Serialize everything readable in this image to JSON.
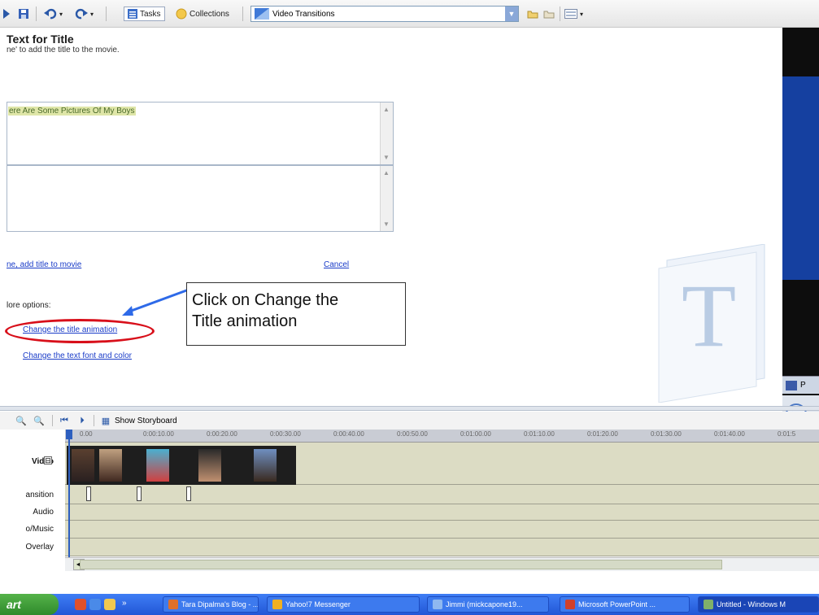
{
  "toolbar": {
    "tasks_label": "Tasks",
    "collections_label": "Collections",
    "collection_combo": "Video Transitions"
  },
  "task_pane": {
    "heading": "Text for Title",
    "instruction": "ne' to add the title to the movie.",
    "title_text": "ere Are Some Pictures Of My Boys",
    "second_line_text": "",
    "done_link": "ne, add title to movie",
    "cancel_link": "Cancel",
    "more_options": "lore options:",
    "change_animation_link": "Change the title animation",
    "change_font_link": "Change the text font and color"
  },
  "callout": {
    "line1": "Click on Change the",
    "line2": "Title animation"
  },
  "preview": {
    "label": "P"
  },
  "timeline": {
    "show_storyboard": "Show Storyboard",
    "ruler_ticks": [
      "0.00",
      "0:00:10.00",
      "0:00:20.00",
      "0:00:30.00",
      "0:00:40.00",
      "0:00:50.00",
      "0:01:00.00",
      "0:01:10.00",
      "0:01:20.00",
      "0:01:30.00",
      "0:01:40.00",
      "0:01:5"
    ],
    "tracks": {
      "video": "Video",
      "transition": "ansition",
      "audio": "Audio",
      "music": "o/Music",
      "overlay": "Overlay"
    },
    "collapse_symbol": "⊟"
  },
  "taskbar": {
    "start": "art",
    "tasks": [
      {
        "label": "Tara Dipalma's Blog - ...",
        "icon_color": "#e0702a"
      },
      {
        "label": "Yahoo!7 Messenger",
        "icon_color": "#f0b020"
      },
      {
        "label": "Jimmi (mickcapone19...",
        "icon_color": "#8fb8f0"
      },
      {
        "label": "Microsoft PowerPoint ...",
        "icon_color": "#d0402a"
      },
      {
        "label": "Untitled - Windows M",
        "icon_color": "#7fb06a"
      }
    ]
  },
  "colors": {
    "link": "#1a3cc8",
    "highlight": "#d80f1a",
    "arrow": "#2e6ae8",
    "preview_screen": "#1540a0"
  }
}
